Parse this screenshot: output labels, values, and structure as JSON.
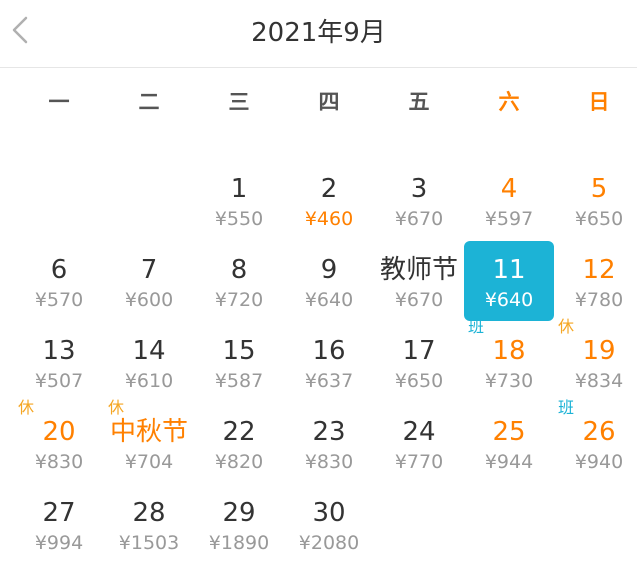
{
  "header": {
    "title": "2021年9月",
    "back_icon": "chevron-left-icon"
  },
  "weekdays": [
    "一",
    "二",
    "三",
    "四",
    "五",
    "六",
    "日"
  ],
  "colors": {
    "accent": "#ff8000",
    "selected": "#1cb3d6",
    "rest_tag": "#f5a623"
  },
  "days": [
    {
      "day": "1",
      "price": "¥550"
    },
    {
      "day": "2",
      "price": "¥460",
      "low": true
    },
    {
      "day": "3",
      "price": "¥670"
    },
    {
      "day": "4",
      "price": "¥597"
    },
    {
      "day": "5",
      "price": "¥650"
    },
    {
      "day": "6",
      "price": "¥570"
    },
    {
      "day": "7",
      "price": "¥600"
    },
    {
      "day": "8",
      "price": "¥720"
    },
    {
      "day": "9",
      "price": "¥640"
    },
    {
      "day": "教师节",
      "price": "¥670"
    },
    {
      "day": "11",
      "price": "¥640",
      "selected": true
    },
    {
      "day": "12",
      "price": "¥780"
    },
    {
      "day": "13",
      "price": "¥507"
    },
    {
      "day": "14",
      "price": "¥610"
    },
    {
      "day": "15",
      "price": "¥587"
    },
    {
      "day": "16",
      "price": "¥637"
    },
    {
      "day": "17",
      "price": "¥650"
    },
    {
      "day": "18",
      "price": "¥730",
      "tag": "班",
      "tag_type": "work"
    },
    {
      "day": "19",
      "price": "¥834",
      "tag": "休",
      "tag_type": "rest"
    },
    {
      "day": "20",
      "price": "¥830",
      "tag": "休",
      "tag_type": "rest",
      "holiday": true
    },
    {
      "day": "中秋节",
      "price": "¥704",
      "tag": "休",
      "tag_type": "rest",
      "holiday": true
    },
    {
      "day": "22",
      "price": "¥820"
    },
    {
      "day": "23",
      "price": "¥830"
    },
    {
      "day": "24",
      "price": "¥770"
    },
    {
      "day": "25",
      "price": "¥944"
    },
    {
      "day": "26",
      "price": "¥940",
      "tag": "班",
      "tag_type": "work"
    },
    {
      "day": "27",
      "price": "¥994"
    },
    {
      "day": "28",
      "price": "¥1503"
    },
    {
      "day": "29",
      "price": "¥1890"
    },
    {
      "day": "30",
      "price": "¥2080"
    }
  ]
}
